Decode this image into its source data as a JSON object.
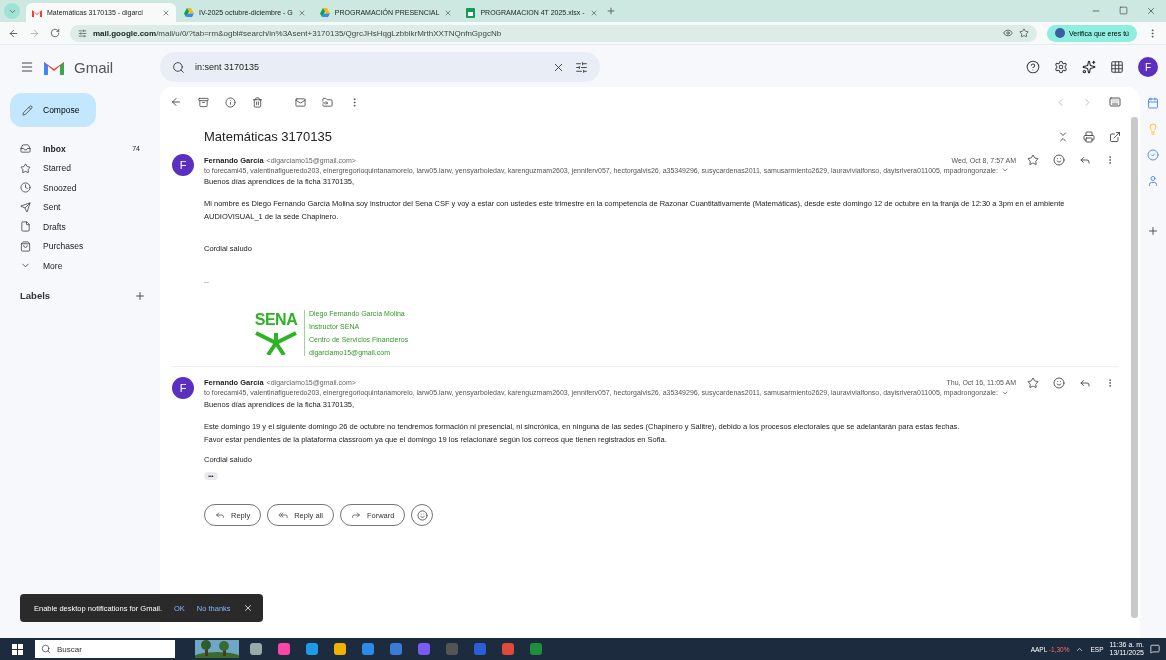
{
  "browser": {
    "tabs": [
      {
        "title": "Matemáticas 3170135 - digarci",
        "kind": "gmail",
        "selected": true
      },
      {
        "title": "IV-2025 octubre-diciembre - G",
        "kind": "drive",
        "selected": false
      },
      {
        "title": "PROGRAMACIÓN PRESENCIAL",
        "kind": "drive",
        "selected": false
      },
      {
        "title": "PROGRAMACION 4T 2025.xlsx -",
        "kind": "sheets",
        "selected": false
      }
    ],
    "url_host": "mail.google.com",
    "url_path": "/mail/u/0/?tab=rm&ogbl#search/in%3Asent+3170135/QgrcJHsHqgLzbblkrMrthXXTNQnfnGpgcNb",
    "profile_button": "Verifica que eres tú"
  },
  "gmail": {
    "logo": "Gmail",
    "compose": "Compose",
    "search": "in:sent 3170135",
    "avatar": "F",
    "nav": [
      {
        "label": "Inbox",
        "count": "74",
        "unread": true
      },
      {
        "label": "Starred",
        "unread": false
      },
      {
        "label": "Snoozed",
        "unread": false
      },
      {
        "label": "Sent",
        "unread": false
      },
      {
        "label": "Drafts",
        "unread": false
      },
      {
        "label": "Purchases",
        "unread": false
      },
      {
        "label": "More",
        "unread": false
      }
    ],
    "labels_heading": "Labels"
  },
  "thread": {
    "subject": "Matemáticas 3170135",
    "messages": [
      {
        "avatar": "F",
        "sender": "Fernando García",
        "email": "<digarciamo15@gmail.com>",
        "date": "Wed, Oct 8, 7:57 AM",
        "recipients": "to forecami45, valentinafigueredo203, einergregorioquintanamorelo, larw05.larw, yensyarboledav, karenguzmam2603, jenniferv057, hectorgalvis26, a35349296, susycardenas2011, samusarmiento2629, lauravivialfonso, dayisrivera011005, mpadrongonzale:",
        "greeting": "Buenos días aprendices de la ficha 3170135,",
        "paragraphs": [
          "Mi nombre es Diego Fernando García Molina soy instructor del Sena CSF y voy a estar con ustedes este trimestre en la competencia de Razonar Cuantitativamente (Matemáticas), desde este domingo 12 de octubre en la franja de 12:30 a 3pm en el ambiente AUDIOVISUAL_1 de la sede Chapinero."
        ],
        "closing": "Cordial saludo",
        "separator": "--",
        "signature": {
          "logo": "SENA",
          "lines": [
            "Diego Fernando García Molina",
            "Instructor SENA",
            "Centro de Servicios Financieros",
            "digarciamo15@gmail.com"
          ]
        }
      },
      {
        "avatar": "F",
        "sender": "Fernando García",
        "email": "<digarciamo15@gmail.com>",
        "date": "Thu, Oct 16, 11:05 AM",
        "recipients": "to forecami45, valentinafigueredo203, einergregorioquintanamorelo, larw05.larw, yensyarboledav, karenguzmam2603, jenniferv057, hectorgalvis26, a35349296, susycardenas2011, samusarmiento2629, lauravivialfonso, dayisrivera011005, mpadrongonzale:",
        "greeting": "Buenos días aprendices de la ficha 3170135,",
        "paragraphs": [
          "Este domingo 19 y el siguiente domingo 26 de octubre no tendremos formación ni presencial, ni sincrónica, en ninguna de las sedes (Chapinero y Salitre), debido a los procesos electorales que se adelantarán para estas fechas.",
          "Favor estar pendientes de la plataforma classroom ya que el domingo 19 los relacionaré según los correos que tienen registrados en Sofia."
        ],
        "closing": "Cordial saludo",
        "trimmed": "•••"
      }
    ],
    "actions": [
      "Reply",
      "Reply all",
      "Forward"
    ]
  },
  "snackbar": {
    "text": "Enable desktop notifications for Gmail.",
    "ok": "OK",
    "dismiss": "No thanks"
  },
  "taskbar": {
    "search": "Buscar",
    "ticker": "AAPL",
    "change": "-1,30%",
    "lang": "ESP",
    "time": "11:36 a. m.",
    "date": "13/11/2025"
  }
}
